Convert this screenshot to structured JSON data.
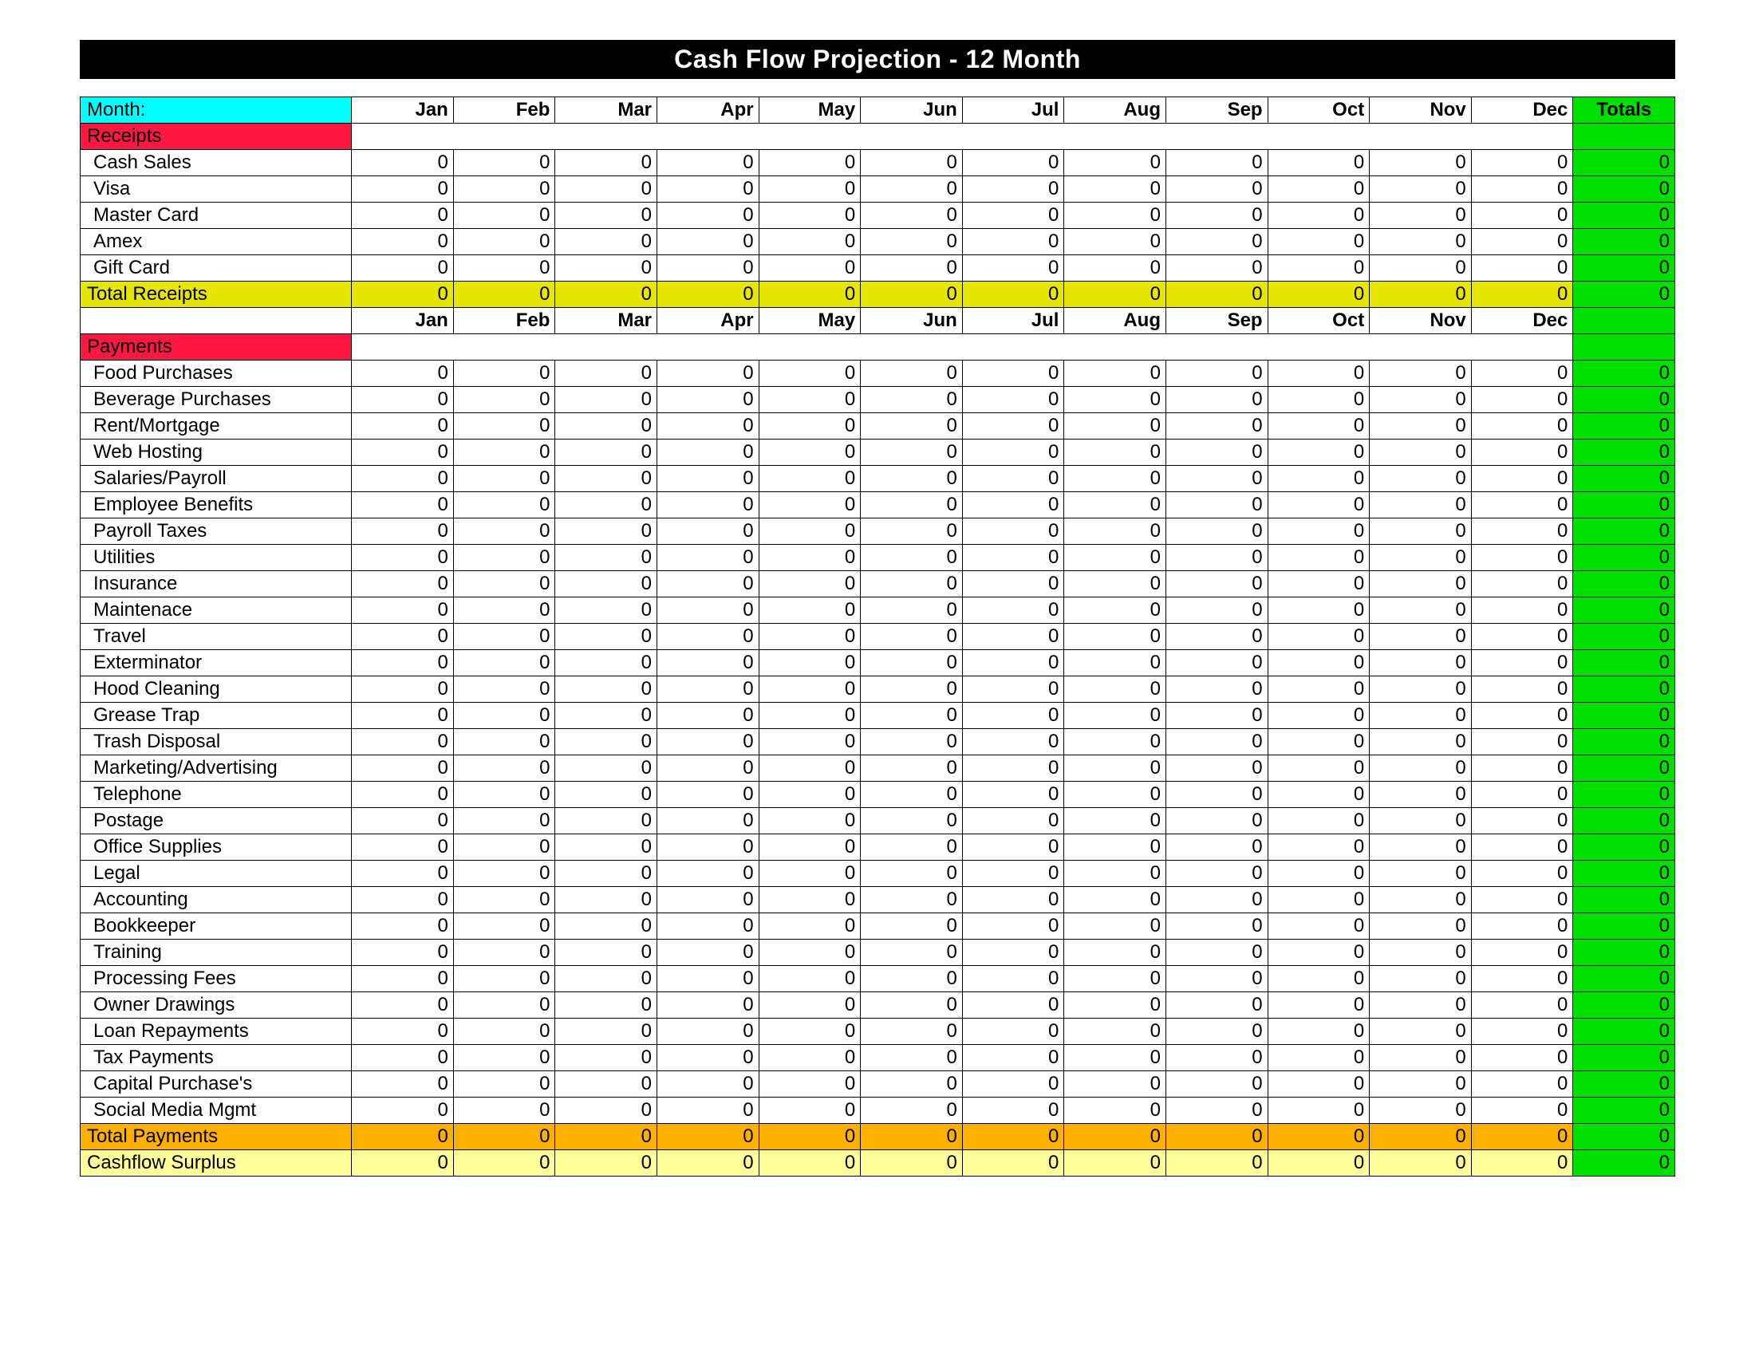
{
  "title": "Cash Flow Projection   -     12 Month",
  "month_label": "Month:",
  "months": [
    "Jan",
    "Feb",
    "Mar",
    "Apr",
    "May",
    "Jun",
    "Jul",
    "Aug",
    "Sep",
    "Oct",
    "Nov",
    "Dec"
  ],
  "totals_label": "Totals",
  "receipts_section": "Receipts",
  "receipts": [
    {
      "label": "Cash Sales",
      "values": [
        0,
        0,
        0,
        0,
        0,
        0,
        0,
        0,
        0,
        0,
        0,
        0
      ],
      "total": 0
    },
    {
      "label": "Visa",
      "values": [
        0,
        0,
        0,
        0,
        0,
        0,
        0,
        0,
        0,
        0,
        0,
        0
      ],
      "total": 0
    },
    {
      "label": "Master Card",
      "values": [
        0,
        0,
        0,
        0,
        0,
        0,
        0,
        0,
        0,
        0,
        0,
        0
      ],
      "total": 0
    },
    {
      "label": "Amex",
      "values": [
        0,
        0,
        0,
        0,
        0,
        0,
        0,
        0,
        0,
        0,
        0,
        0
      ],
      "total": 0
    },
    {
      "label": "Gift Card",
      "values": [
        0,
        0,
        0,
        0,
        0,
        0,
        0,
        0,
        0,
        0,
        0,
        0
      ],
      "total": 0
    }
  ],
  "total_receipts": {
    "label": "Total Receipts",
    "values": [
      0,
      0,
      0,
      0,
      0,
      0,
      0,
      0,
      0,
      0,
      0,
      0
    ],
    "total": 0
  },
  "payments_section": "Payments",
  "payments": [
    {
      "label": "Food Purchases",
      "values": [
        0,
        0,
        0,
        0,
        0,
        0,
        0,
        0,
        0,
        0,
        0,
        0
      ],
      "total": 0
    },
    {
      "label": "Beverage Purchases",
      "values": [
        0,
        0,
        0,
        0,
        0,
        0,
        0,
        0,
        0,
        0,
        0,
        0
      ],
      "total": 0
    },
    {
      "label": "Rent/Mortgage",
      "values": [
        0,
        0,
        0,
        0,
        0,
        0,
        0,
        0,
        0,
        0,
        0,
        0
      ],
      "total": 0
    },
    {
      "label": "Web Hosting",
      "values": [
        0,
        0,
        0,
        0,
        0,
        0,
        0,
        0,
        0,
        0,
        0,
        0
      ],
      "total": 0
    },
    {
      "label": "Salaries/Payroll",
      "values": [
        0,
        0,
        0,
        0,
        0,
        0,
        0,
        0,
        0,
        0,
        0,
        0
      ],
      "total": 0
    },
    {
      "label": "Employee Benefits",
      "values": [
        0,
        0,
        0,
        0,
        0,
        0,
        0,
        0,
        0,
        0,
        0,
        0
      ],
      "total": 0
    },
    {
      "label": "Payroll Taxes",
      "values": [
        0,
        0,
        0,
        0,
        0,
        0,
        0,
        0,
        0,
        0,
        0,
        0
      ],
      "total": 0
    },
    {
      "label": "Utilities",
      "values": [
        0,
        0,
        0,
        0,
        0,
        0,
        0,
        0,
        0,
        0,
        0,
        0
      ],
      "total": 0
    },
    {
      "label": "Insurance",
      "values": [
        0,
        0,
        0,
        0,
        0,
        0,
        0,
        0,
        0,
        0,
        0,
        0
      ],
      "total": 0
    },
    {
      "label": "Maintenace",
      "values": [
        0,
        0,
        0,
        0,
        0,
        0,
        0,
        0,
        0,
        0,
        0,
        0
      ],
      "total": 0
    },
    {
      "label": "Travel",
      "values": [
        0,
        0,
        0,
        0,
        0,
        0,
        0,
        0,
        0,
        0,
        0,
        0
      ],
      "total": 0
    },
    {
      "label": "Exterminator",
      "values": [
        0,
        0,
        0,
        0,
        0,
        0,
        0,
        0,
        0,
        0,
        0,
        0
      ],
      "total": 0
    },
    {
      "label": "Hood Cleaning",
      "values": [
        0,
        0,
        0,
        0,
        0,
        0,
        0,
        0,
        0,
        0,
        0,
        0
      ],
      "total": 0
    },
    {
      "label": "Grease Trap",
      "values": [
        0,
        0,
        0,
        0,
        0,
        0,
        0,
        0,
        0,
        0,
        0,
        0
      ],
      "total": 0
    },
    {
      "label": "Trash Disposal",
      "values": [
        0,
        0,
        0,
        0,
        0,
        0,
        0,
        0,
        0,
        0,
        0,
        0
      ],
      "total": 0
    },
    {
      "label": "Marketing/Advertising",
      "values": [
        0,
        0,
        0,
        0,
        0,
        0,
        0,
        0,
        0,
        0,
        0,
        0
      ],
      "total": 0
    },
    {
      "label": "Telephone",
      "values": [
        0,
        0,
        0,
        0,
        0,
        0,
        0,
        0,
        0,
        0,
        0,
        0
      ],
      "total": 0
    },
    {
      "label": "Postage",
      "values": [
        0,
        0,
        0,
        0,
        0,
        0,
        0,
        0,
        0,
        0,
        0,
        0
      ],
      "total": 0
    },
    {
      "label": "Office Supplies",
      "values": [
        0,
        0,
        0,
        0,
        0,
        0,
        0,
        0,
        0,
        0,
        0,
        0
      ],
      "total": 0
    },
    {
      "label": "Legal",
      "values": [
        0,
        0,
        0,
        0,
        0,
        0,
        0,
        0,
        0,
        0,
        0,
        0
      ],
      "total": 0
    },
    {
      "label": "Accounting",
      "values": [
        0,
        0,
        0,
        0,
        0,
        0,
        0,
        0,
        0,
        0,
        0,
        0
      ],
      "total": 0
    },
    {
      "label": "Bookkeeper",
      "values": [
        0,
        0,
        0,
        0,
        0,
        0,
        0,
        0,
        0,
        0,
        0,
        0
      ],
      "total": 0
    },
    {
      "label": "Training",
      "values": [
        0,
        0,
        0,
        0,
        0,
        0,
        0,
        0,
        0,
        0,
        0,
        0
      ],
      "total": 0
    },
    {
      "label": "Processing Fees",
      "values": [
        0,
        0,
        0,
        0,
        0,
        0,
        0,
        0,
        0,
        0,
        0,
        0
      ],
      "total": 0
    },
    {
      "label": "Owner Drawings",
      "values": [
        0,
        0,
        0,
        0,
        0,
        0,
        0,
        0,
        0,
        0,
        0,
        0
      ],
      "total": 0
    },
    {
      "label": "Loan Repayments",
      "values": [
        0,
        0,
        0,
        0,
        0,
        0,
        0,
        0,
        0,
        0,
        0,
        0
      ],
      "total": 0
    },
    {
      "label": "Tax Payments",
      "values": [
        0,
        0,
        0,
        0,
        0,
        0,
        0,
        0,
        0,
        0,
        0,
        0
      ],
      "total": 0
    },
    {
      "label": "Capital Purchase's",
      "values": [
        0,
        0,
        0,
        0,
        0,
        0,
        0,
        0,
        0,
        0,
        0,
        0
      ],
      "total": 0
    },
    {
      "label": "Social Media Mgmt",
      "values": [
        0,
        0,
        0,
        0,
        0,
        0,
        0,
        0,
        0,
        0,
        0,
        0
      ],
      "total": 0
    }
  ],
  "total_payments": {
    "label": "Total Payments",
    "values": [
      0,
      0,
      0,
      0,
      0,
      0,
      0,
      0,
      0,
      0,
      0,
      0
    ],
    "total": 0
  },
  "cashflow_surplus": {
    "label": "Cashflow Surplus",
    "values": [
      0,
      0,
      0,
      0,
      0,
      0,
      0,
      0,
      0,
      0,
      0,
      0
    ],
    "total": 0
  }
}
